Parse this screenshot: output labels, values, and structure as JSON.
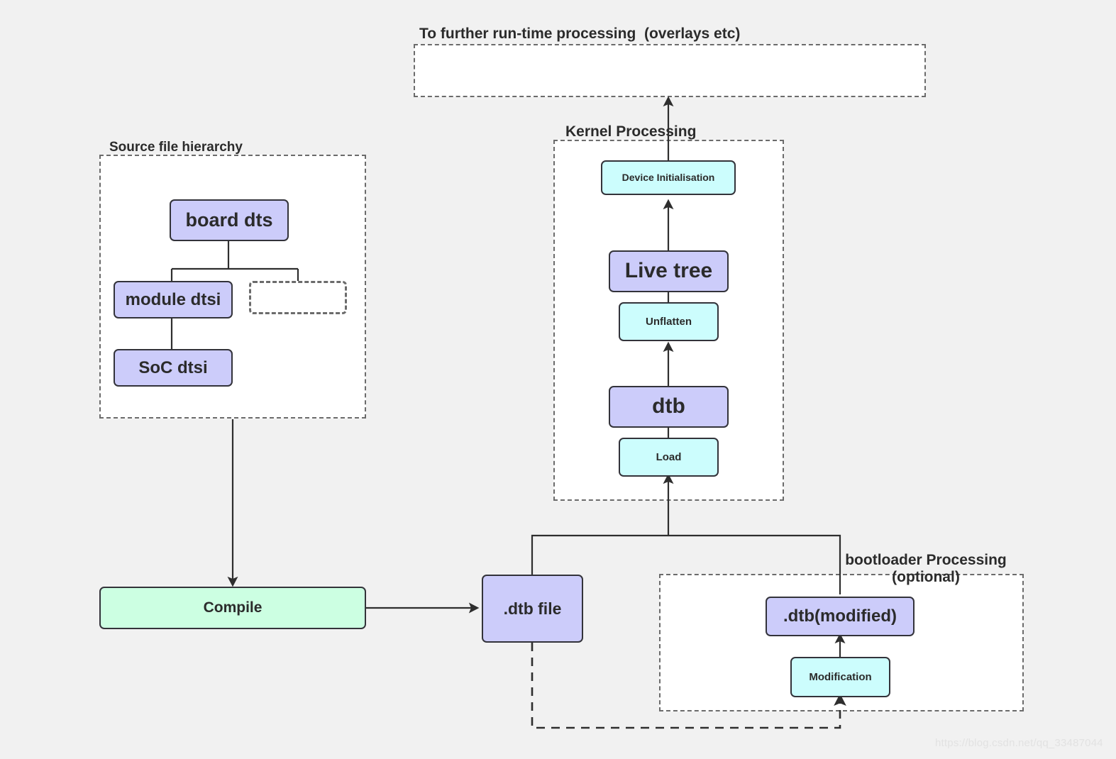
{
  "diagram": {
    "title_top": "To further run-time processing  (overlays etc)",
    "groups": [
      {
        "id": "runtime",
        "label": "To further run-time processing  (overlays etc)"
      },
      {
        "id": "source",
        "label": "Source file hierarchy"
      },
      {
        "id": "kernel",
        "label": "Kernel Processing"
      },
      {
        "id": "bootloader",
        "label": "bootloader Processing\n(optional)"
      }
    ],
    "nodes": {
      "board_dts": {
        "label": "board dts",
        "color": "#ccccfa",
        "kind": "data"
      },
      "module_dtsi": {
        "label": "module dtsi",
        "color": "#ccccfa",
        "kind": "data"
      },
      "soc_dtsi": {
        "label": "SoC dtsi",
        "color": "#ccccfa",
        "kind": "data"
      },
      "placeholder": {
        "label": "",
        "color": "none",
        "kind": "placeholder"
      },
      "compile": {
        "label": "Compile",
        "color": "#ccffe2",
        "kind": "process"
      },
      "dtb_file": {
        "label": ".dtb file",
        "color": "#ccccfa",
        "kind": "data"
      },
      "dtb_modified": {
        "label": ".dtb(modified)",
        "color": "#ccccfa",
        "kind": "data"
      },
      "modification": {
        "label": "Modification",
        "color": "#ccfdfd",
        "kind": "process"
      },
      "load": {
        "label": "Load",
        "color": "#ccfdfd",
        "kind": "process"
      },
      "dtb": {
        "label": "dtb",
        "color": "#ccccfa",
        "kind": "data"
      },
      "unflatten": {
        "label": "Unflatten",
        "color": "#ccfdfd",
        "kind": "process"
      },
      "live_tree": {
        "label": "Live tree",
        "color": "#ccccfa",
        "kind": "data"
      },
      "device_init": {
        "label": "Device Initialisation",
        "color": "#ccfdfd",
        "kind": "process"
      }
    },
    "watermark": "https://blog.csdn.net/qq_33487044",
    "colors": {
      "background": "#f1f1f1",
      "group_border": "#6b6b6b",
      "node_border": "#33333a",
      "line": "#333333",
      "purple": "#ccccfa",
      "cyan": "#ccfdfd",
      "green": "#ccffe2"
    }
  }
}
